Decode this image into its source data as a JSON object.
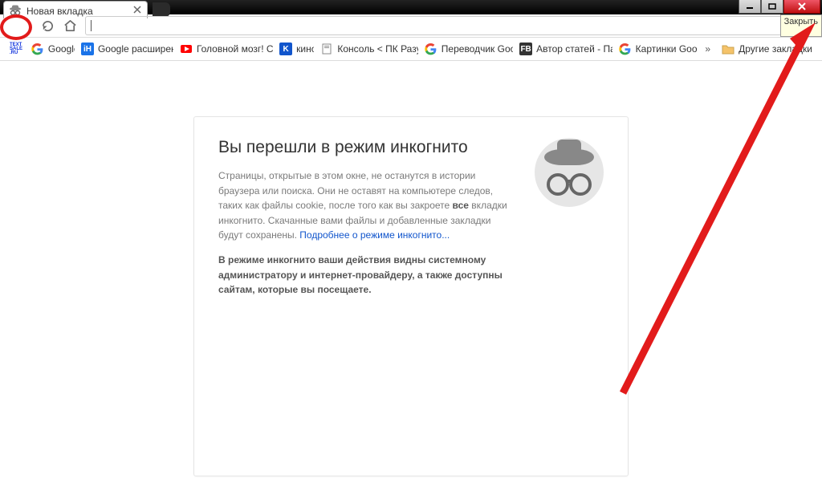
{
  "window": {
    "tab_title": "Новая вкладка",
    "close_tooltip": "Закрыть"
  },
  "bookmarks": {
    "items": [
      {
        "label": "",
        "icon": "textsale",
        "bg": "#fff",
        "color": "#33a"
      },
      {
        "label": "Google",
        "icon": "G",
        "bg": "#fff",
        "color": "#4285f4"
      },
      {
        "label": "Google расширенн...",
        "icon": "iH",
        "bg": "#1a73e8",
        "color": "#fff"
      },
      {
        "label": "Головной мозг! Сут...",
        "icon": "▶",
        "bg": "#f00",
        "color": "#fff"
      },
      {
        "label": "кино",
        "icon": "K",
        "bg": "#15c",
        "color": "#fff"
      },
      {
        "label": "Консоль < ПК Разум...",
        "icon": "□",
        "bg": "#fff",
        "color": "#777"
      },
      {
        "label": "Переводчик Google",
        "icon": "G",
        "bg": "#fff",
        "color": "#4285f4"
      },
      {
        "label": "Автор статей - Пав...",
        "icon": "FB",
        "bg": "#333",
        "color": "#fff"
      },
      {
        "label": "Картинки Google",
        "icon": "G",
        "bg": "#fff",
        "color": "#4285f4"
      }
    ],
    "overflow": "»",
    "other": "Другие закладки"
  },
  "page": {
    "heading": "Вы перешли в режим инкогнито",
    "p1_a": "Страницы, открытые в этом окне, не останутся в истории браузера или поиска. Они не оставят на компьютере следов, таких как файлы cookie, после того как вы закроете ",
    "p1_bold": "все",
    "p1_b": " вкладки инкогнито. Скачанные вами файлы и добавленные закладки будут сохранены. ",
    "link": "Подробнее о режиме инкогнито...",
    "p2": "В режиме инкогнито ваши действия видны системному администратору и интернет-провайдеру, а также доступны сайтам, которые вы посещаете."
  }
}
